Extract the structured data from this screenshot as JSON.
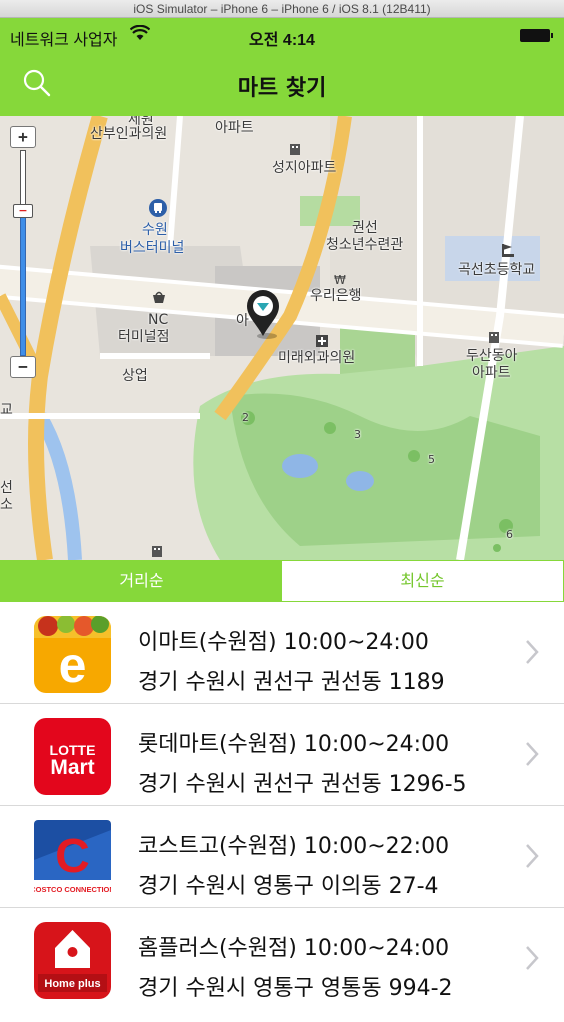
{
  "simulator_title": "iOS Simulator – iPhone 6 – iPhone 6 / iOS 8.1 (12B411)",
  "status_bar": {
    "carrier": "네트워크 사업자",
    "time": "오전 4:14"
  },
  "nav": {
    "title": "마트 찾기",
    "search_icon": "search-icon"
  },
  "map": {
    "labels": {
      "hospital_top": "산부인과의원",
      "apartment_top": "아파트",
      "seongji_apt": "성지아파트",
      "suwon": "수원",
      "bus_terminal": "버스터미널",
      "kwonseon": "권선",
      "youth_hall": "청소년수련관",
      "gokseon_school": "곡선초등학교",
      "woori_bank": "우리은행",
      "nc": "NC",
      "terminal_store": "터미널점",
      "mirae_clinic": "미래외과의원",
      "dusan": "두산동아",
      "apartment": "아파트",
      "commerce": "상업",
      "left_edge_1": "교",
      "left_edge_2": "선",
      "left_edge_3": "소",
      "top_cut": "세원",
      "marker_text": "아"
    },
    "zoom": {
      "plus": "+",
      "minus": "−",
      "handle": "−"
    },
    "course_numbers": [
      "2",
      "3",
      "5",
      "6"
    ]
  },
  "sort": {
    "tabs": [
      {
        "label": "거리순",
        "selected": true
      },
      {
        "label": "최신순",
        "selected": false
      }
    ]
  },
  "stores": [
    {
      "name_hours": "이마트(수원점)  10:00~24:00",
      "address": "경기 수원시 권선구 권선동 1189",
      "logo": "emart-logo",
      "logo_text": "e"
    },
    {
      "name_hours": "롯데마트(수원점) 10:00~24:00",
      "address": "경기 수원시 권선구 권선동 1296-5",
      "logo": "lotte-mart-logo",
      "logo_text": "LOTTE",
      "logo_text2": "Mart"
    },
    {
      "name_hours": "코스트고(수원점) 10:00~22:00",
      "address": "경기 수원시 영통구 이의동 27-4",
      "logo": "costco-logo",
      "logo_text": "C",
      "logo_text2": "COSTCO CONNECTION"
    },
    {
      "name_hours": "홈플러스(수원점) 10:00~24:00",
      "address": "경기 수원시 영통구 영통동 994-2",
      "logo": "homeplus-logo",
      "logo_text": "Home plus"
    }
  ],
  "colors": {
    "accent": "#86d83a",
    "accent_text": "#74c62b",
    "divider": "#d9d9d9"
  }
}
